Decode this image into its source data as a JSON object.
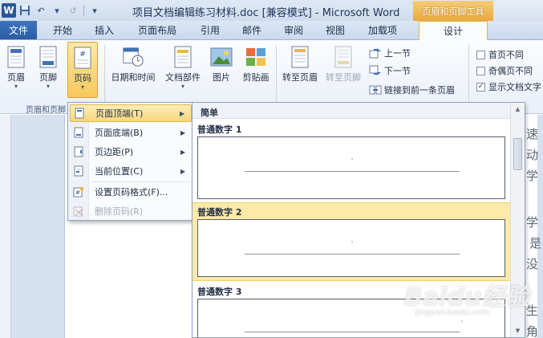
{
  "window": {
    "title": "项目文档编辑练习材料.doc [兼容模式] - Microsoft Word",
    "context_tab_title": "页眉和页脚工具"
  },
  "quick_access": {
    "app_icon": "word-icon",
    "undo_label": "↶",
    "redo_label": "↺"
  },
  "tabs": [
    "文件",
    "开始",
    "插入",
    "页面布局",
    "引用",
    "邮件",
    "审阅",
    "视图",
    "加载项",
    "设计"
  ],
  "ribbon": {
    "header_footer_group": {
      "label": "页眉和页脚",
      "buttons": [
        "页眉",
        "页脚",
        "页码"
      ]
    },
    "insert_buttons": [
      "日期和时间",
      "文档部件",
      "图片",
      "剪贴画"
    ],
    "navigation": {
      "goto_header": "转至页眉",
      "goto_footer": "转至页脚",
      "prev_section": "上一节",
      "next_section": "下一节",
      "link_previous": "链接到前一条页眉"
    },
    "options": [
      {
        "label": "首页不同",
        "checked": false
      },
      {
        "label": "奇偶页不同",
        "checked": false
      },
      {
        "label": "显示文档文字",
        "checked": true
      }
    ]
  },
  "page_number_menu": {
    "items": [
      {
        "label": "页面顶端(T)",
        "has_submenu": true,
        "highlighted": true,
        "disabled": false
      },
      {
        "label": "页面底端(B)",
        "has_submenu": true,
        "highlighted": false,
        "disabled": false
      },
      {
        "label": "页边距(P)",
        "has_submenu": true,
        "highlighted": false,
        "disabled": false
      },
      {
        "label": "当前位置(C)",
        "has_submenu": true,
        "highlighted": false,
        "disabled": false
      },
      {
        "label": "设置页码格式(F)...",
        "has_submenu": false,
        "highlighted": false,
        "disabled": false
      },
      {
        "label": "删除页码(R)",
        "has_submenu": false,
        "highlighted": false,
        "disabled": true
      }
    ]
  },
  "gallery": {
    "section": "简单",
    "items": [
      {
        "label": "普通数字 1",
        "highlighted": false
      },
      {
        "label": "普通数字 2",
        "highlighted": true
      },
      {
        "label": "普通数字 3",
        "highlighted": false
      }
    ]
  },
  "document": {
    "lines": [
      "速",
      "动",
      "学",
      "学",
      "是",
      "没",
      "生",
      "角"
    ]
  },
  "watermark": {
    "text": "Baidu经验",
    "url": "jingyan.baidu.com"
  }
}
